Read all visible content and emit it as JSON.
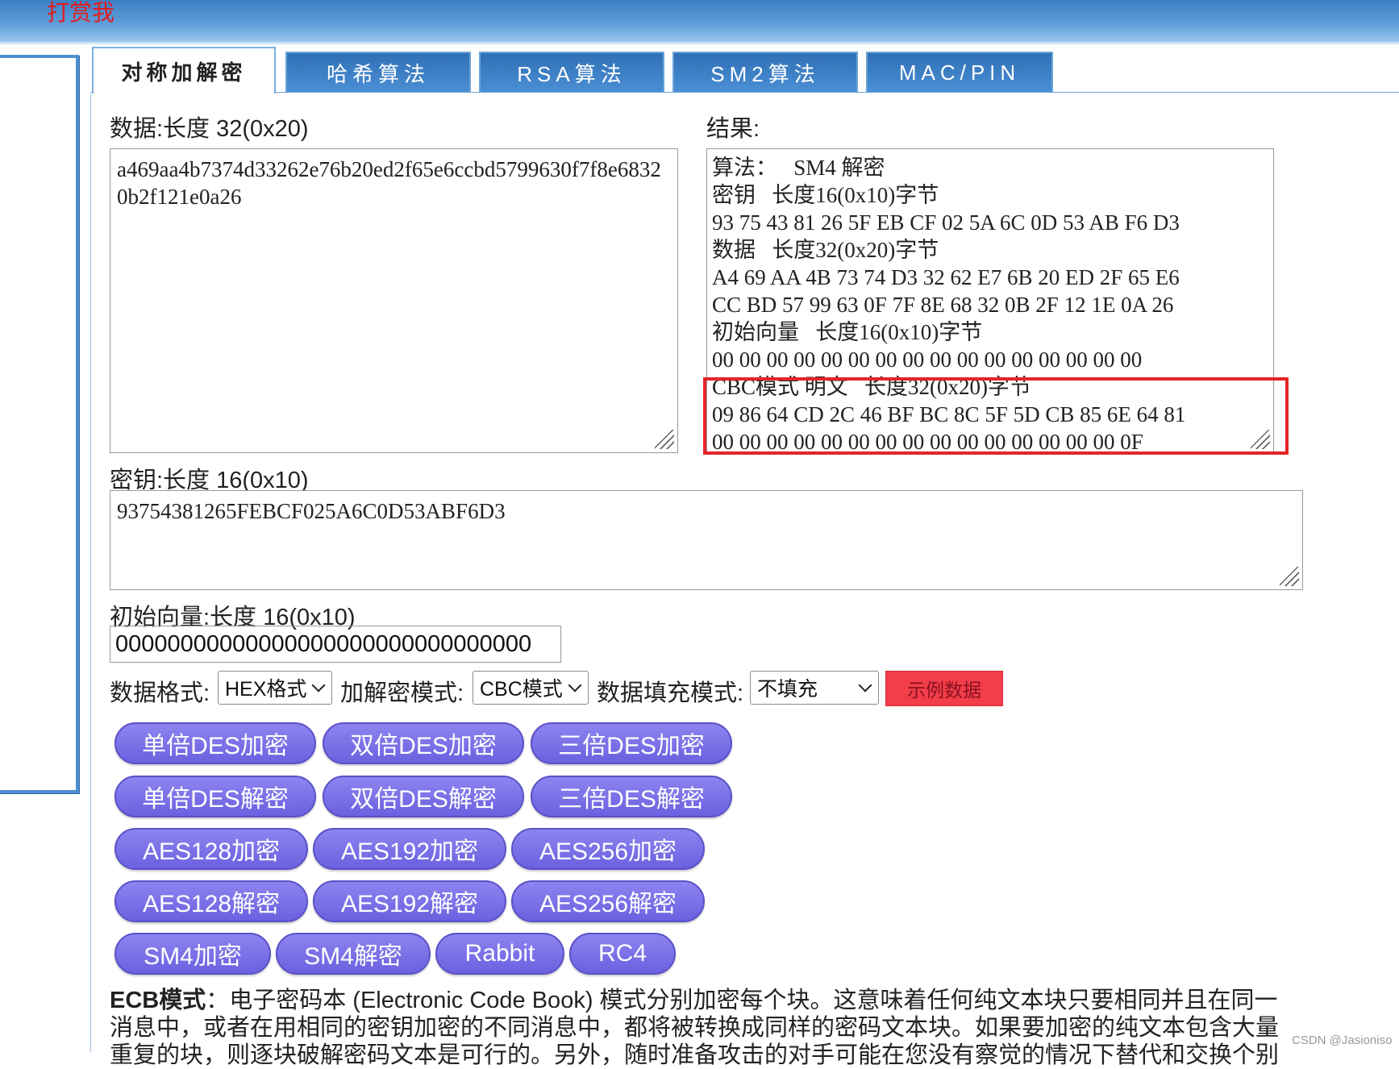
{
  "header": {
    "donate_label": "打赏我"
  },
  "tabs": [
    {
      "label": "对称加解密",
      "active": true
    },
    {
      "label": "哈希算法"
    },
    {
      "label": "RSA算法"
    },
    {
      "label": "SM2算法"
    },
    {
      "label": "MAC/PIN"
    }
  ],
  "data_field": {
    "label": "数据:长度 32(0x20)",
    "value": "a469aa4b7374d33262e76b20ed2f65e6ccbd5799630f7f8e68320b2f121e0a26"
  },
  "result": {
    "label": "结果:",
    "lines": [
      "算法：   SM4 解密",
      "密钥   长度16(0x10)字节",
      "93 75 43 81 26 5F EB CF 02 5A 6C 0D 53 AB F6 D3",
      "数据   长度32(0x20)字节",
      "A4 69 AA 4B 73 74 D3 32 62 E7 6B 20 ED 2F 65 E6",
      "CC BD 57 99 63 0F 7F 8E 68 32 0B 2F 12 1E 0A 26",
      "初始向量   长度16(0x10)字节",
      "00 00 00 00 00 00 00 00 00 00 00 00 00 00 00 00",
      "CBC模式 明文   长度32(0x20)字节",
      "09 86 64 CD 2C 46 BF BC 8C 5F 5D CB 85 6E 64 81",
      "00 00 00 00 00 00 00 00 00 00 00 00 00 00 00 0F"
    ],
    "highlight_color": "#e52428"
  },
  "key_field": {
    "label": "密钥:长度 16(0x10)",
    "value": "93754381265FEBCF025A6C0D53ABF6D3"
  },
  "iv_field": {
    "label": "初始向量:长度 16(0x10)",
    "value": "00000000000000000000000000000000"
  },
  "options": {
    "format_label": "数据格式:",
    "format_value": "HEX格式",
    "mode_label": "加解密模式:",
    "mode_value": "CBC模式",
    "padding_label": "数据填充模式:",
    "padding_value": "不填充",
    "demo_label": "示例数据"
  },
  "buttons": {
    "row1": [
      "单倍DES加密",
      "双倍DES加密",
      "三倍DES加密"
    ],
    "row2": [
      "单倍DES解密",
      "双倍DES解密",
      "三倍DES解密"
    ],
    "row3": [
      "AES128加密",
      "AES192加密",
      "AES256加密"
    ],
    "row4": [
      "AES128解密",
      "AES192解密",
      "AES256解密"
    ],
    "row5": [
      "SM4加密",
      "SM4解密",
      "Rabbit",
      "RC4"
    ]
  },
  "description": {
    "title": "ECB模式",
    "text": "：电子密码本 (Electronic Code Book) 模式分别加密每个块。这意味着任何纯文本块只要相同并且在同一消息中，或者在用相同的密钥加密的不同消息中，都将被转换成同样的密码文本块。如果要加密的纯文本包含大量重复的块，则逐块破解密码文本是可行的。另外，随时准备攻击的对手可能在您没有察觉的情况下替代和交换个别"
  },
  "watermark": "CSDN @Jasioniso",
  "colors": {
    "accent": "#3b7fc4",
    "button": "#7b72ea",
    "demo_button": "#f23e4a"
  }
}
